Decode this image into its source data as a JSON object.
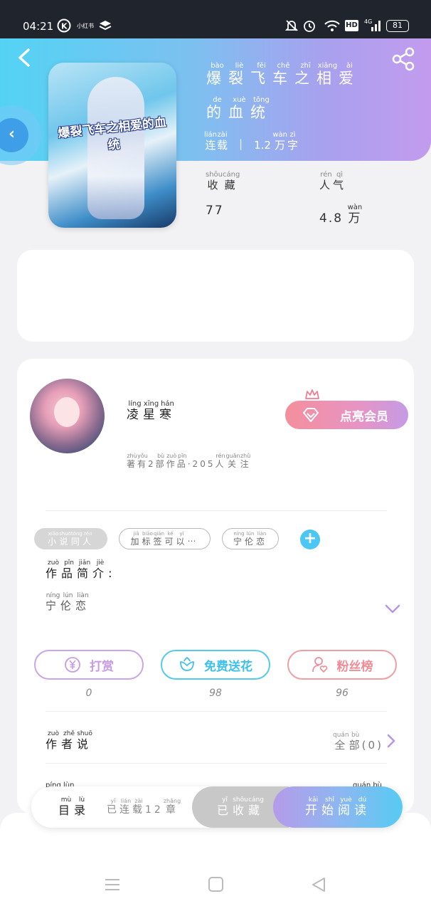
{
  "status_bar": {
    "time": "04:21",
    "battery": "81",
    "icons": [
      "app-k-icon",
      "mute-icon",
      "layers-icon",
      "bell-off-icon",
      "alarm-icon",
      "wifi-icon",
      "hd-icon",
      "signal-4g-icon",
      "battery-icon"
    ],
    "small_label": "小红书",
    "hd_label": "HD",
    "net_label": "4G"
  },
  "book": {
    "title_chars": [
      {
        "c": "爆",
        "p": "bào"
      },
      {
        "c": "裂",
        "p": "liè"
      },
      {
        "c": "飞",
        "p": "fēi"
      },
      {
        "c": "车",
        "p": "chē"
      },
      {
        "c": "之",
        "p": "zhī"
      },
      {
        "c": "相",
        "p": "xiāng"
      },
      {
        "c": "爱",
        "p": "ài"
      },
      {
        "c": "的",
        "p": "de"
      },
      {
        "c": "血",
        "p": "xuè"
      },
      {
        "c": "统",
        "p": "tǒng"
      }
    ],
    "cover_title": "爆裂飞车之相爱的血统",
    "status": {
      "text": "连载",
      "pinyin": [
        "lián",
        "zài"
      ]
    },
    "word_count": {
      "num": "1.2",
      "unit": "万",
      "unit_pinyin": "wàn",
      "suffix": "字",
      "suffix_pinyin": "zì"
    },
    "stats": {
      "collect": {
        "label": "收藏",
        "pinyin": [
          "shōu",
          "cáng"
        ],
        "value": "77"
      },
      "popularity": {
        "label": "人气",
        "pinyin": [
          "rén",
          "qì"
        ],
        "value_num": "4.8",
        "value_unit": "万",
        "value_unit_pinyin": "wàn"
      }
    }
  },
  "author": {
    "name": "凌星寒",
    "name_pinyin": [
      "líng",
      "xīng",
      "hán"
    ],
    "subtitle": "著有2部作品·205人关注",
    "subtitle_pinyin": [
      "zhù",
      "yǒu",
      "",
      "bù",
      "zuò",
      "pǐn",
      "",
      "",
      "",
      "",
      "rén",
      "guān",
      "zhù"
    ],
    "vip_button": "点亮会员"
  },
  "tags": [
    {
      "label": "小说同人",
      "pinyin": [
        "xiǎo",
        "shuō",
        "tóng",
        "rén"
      ]
    },
    {
      "label": "加标签可以…",
      "pinyin": [
        "jiā",
        "biāo",
        "qiān",
        "kě",
        "yǐ",
        ""
      ]
    },
    {
      "label": "宁伦恋",
      "pinyin": [
        "níng",
        "lún",
        "liàn"
      ]
    }
  ],
  "add_tag": "+",
  "intro": {
    "heading": "作品简介:",
    "heading_pinyin": [
      "zuò",
      "pǐn",
      "jiǎn",
      "jiè",
      ""
    ],
    "text": "宁伦恋",
    "text_pinyin": [
      "níng",
      "lún",
      "liàn"
    ]
  },
  "actions": [
    {
      "label": "打赏",
      "count": "0",
      "icon": "yen-coin-icon",
      "color": "#c79be8"
    },
    {
      "label": "免费送花",
      "count": "98",
      "icon": "flower-icon",
      "color": "#3ec0ec"
    },
    {
      "label": "粉丝榜",
      "count": "96",
      "icon": "fan-heart-icon",
      "color": "#ee8d97"
    }
  ],
  "author_says": {
    "label": "作者说",
    "label_pinyin": [
      "zuò",
      "zhě",
      "shuō"
    ],
    "right": "全部(0)",
    "right_pinyin": [
      "quán",
      "bù",
      "",
      "",
      ""
    ]
  },
  "next_row_pinyin": [
    "píng",
    "lùn"
  ],
  "next_row_right_pinyin": [
    "quán",
    "bù"
  ],
  "read_bar": {
    "toc": "目录",
    "toc_pinyin": [
      "mù",
      "lù"
    ],
    "serial": "已连载12章",
    "serial_pinyin": [
      "yǐ",
      "lián",
      "zài",
      "",
      "",
      "zhāng"
    ],
    "collected": "已收藏",
    "collected_pinyin": [
      "yǐ",
      "shōu",
      "cáng"
    ],
    "start": "开始阅读",
    "start_pinyin": [
      "kāi",
      "shǐ",
      "yuè",
      "dú"
    ]
  },
  "system_nav": [
    "menu-icon",
    "home-square-icon",
    "back-triangle-icon"
  ],
  "colors": {
    "header_gradient_start": "#53d3f4",
    "header_gradient_end": "#c39bee",
    "accent_blue": "#4cc6f2",
    "accent_pink": "#ee8d97",
    "accent_purple": "#c79be8"
  }
}
